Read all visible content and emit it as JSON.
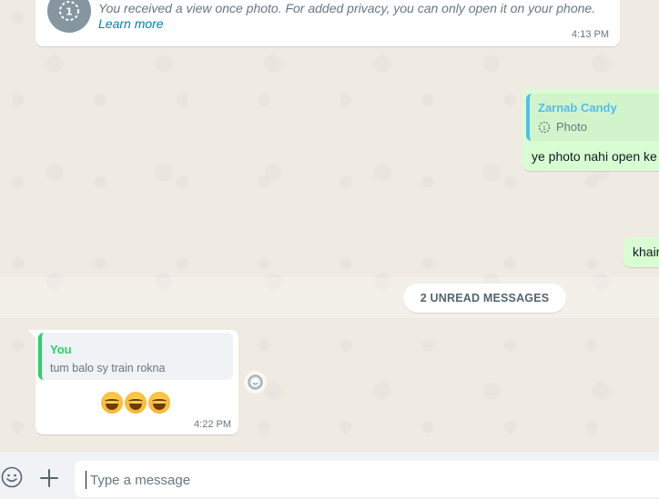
{
  "messages": {
    "view_once": {
      "text": "You received a view once photo. For added privacy, you can only open it on your phone.",
      "learn_more": "Learn more",
      "time": "4:13 PM",
      "icon": "view-once-icon"
    },
    "outgoing_reply": {
      "quote_name": "Zarnab Candy",
      "quote_type": "Photo",
      "text": "ye photo nahi open ke"
    },
    "outgoing_short": {
      "text": "khair"
    },
    "unread_banner": "2 UNREAD MESSAGES",
    "incoming_reply": {
      "quote_name": "You",
      "quote_text": "tum balo sy train rokna",
      "emoji_count": 3,
      "emoji": "face-with-tears-of-joy",
      "time": "4:22 PM"
    }
  },
  "composer": {
    "placeholder": "Type a message",
    "emoji_icon": "smiley-icon",
    "attach_icon": "plus-icon"
  },
  "colors": {
    "chat_bg": "#efeae2",
    "outgoing_bubble": "#d9fdd3",
    "incoming_bubble": "#ffffff",
    "quote_blue": "#53bdeb",
    "quote_green": "#25d366",
    "link": "#027eb5"
  }
}
